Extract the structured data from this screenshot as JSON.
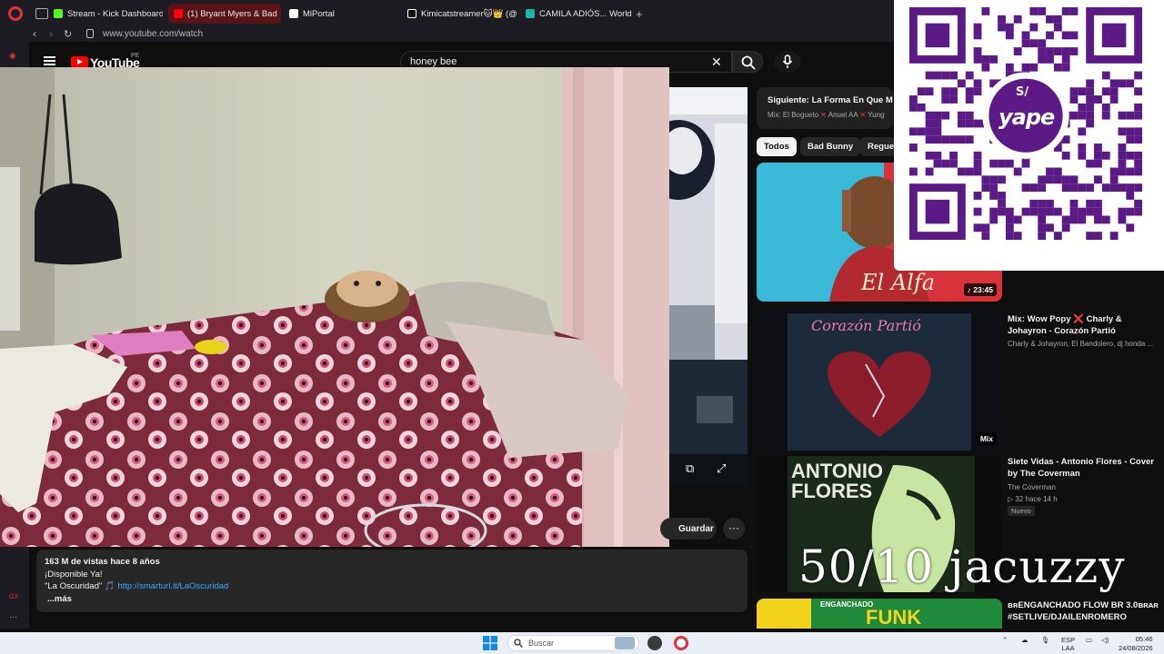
{
  "browser": {
    "tabs": [
      {
        "label": "Stream - Kick Dashboard",
        "icon": "kick-icon",
        "color": "#53fc18"
      },
      {
        "label": "(1) Bryant Myers & Bad",
        "icon": "youtube-icon",
        "color": "#ff0000",
        "active": true
      },
      {
        "label": "MiPortal",
        "icon": "portal-icon",
        "color": "#ffffff"
      },
      {
        "label": "Kimicatstreamer🐱👑 (@",
        "icon": "tiktok-icon",
        "color": "#ffffff"
      },
      {
        "label": "CAMILA ADIÓS... World To",
        "icon": "site-icon",
        "color": "#18b4a6"
      }
    ],
    "url": "www.youtube.com/watch"
  },
  "youtube": {
    "logo": "YouTube",
    "country": "PE",
    "search_query": "honey bee",
    "description": {
      "meta": "163 M de vistas  hace 8 años",
      "line1": "¡Disponible Ya!",
      "line2_prefix": "\"La Oscuridad\" 🎵",
      "link": "http://smarturl.it/LaOscuridad",
      "more": "...más"
    },
    "save_label": "Guardar",
    "next": {
      "label": "Siguiente:",
      "title": "La Forma En Que Me M",
      "sub_a": "Mix: El Bogueto",
      "sub_b": "Anuel AA",
      "sub_c": "Yung"
    },
    "chips": [
      "Todos",
      "Bad Bunny",
      "Regue"
    ],
    "videos": [
      {
        "badge": "♪ 23:45"
      },
      {
        "title": "Mix: Wow Popy ❌ Charly & Johayron - Corazón Partió",
        "channel": "Charly & Johayron, El Bandolero, dj honda ...",
        "badge": "Mix",
        "thumb_text": "Corazón Partió"
      },
      {
        "title": "Siete Vidas - Antonio Flores - Cover by The Coverman",
        "channel": "The Coverman",
        "stats": "▷ 32  hace 14 h",
        "new": "Nuevo",
        "thumb_text": "ANTONIO FLORES"
      },
      {
        "title": "ʙʀENGANCHADO FLOW BR 3.0ʙʀᴀʀ #SETLIVE/DJAILENROMERO",
        "thumb_text": "ENGANCHADO"
      }
    ]
  },
  "overlay": {
    "qr_brand": "yape",
    "qr_currency": "S/",
    "text": "50/10 jacuzzy"
  },
  "taskbar": {
    "search_label": "Buscar",
    "lang1": "ESP",
    "lang2": "LAA",
    "time": "05:46",
    "date": "24/08/2026"
  },
  "colors": {
    "youtube_red": "#ff0000",
    "link_blue": "#3ea6ff",
    "yape_purple": "#5b1a86",
    "opera_red": "#e0323a"
  }
}
